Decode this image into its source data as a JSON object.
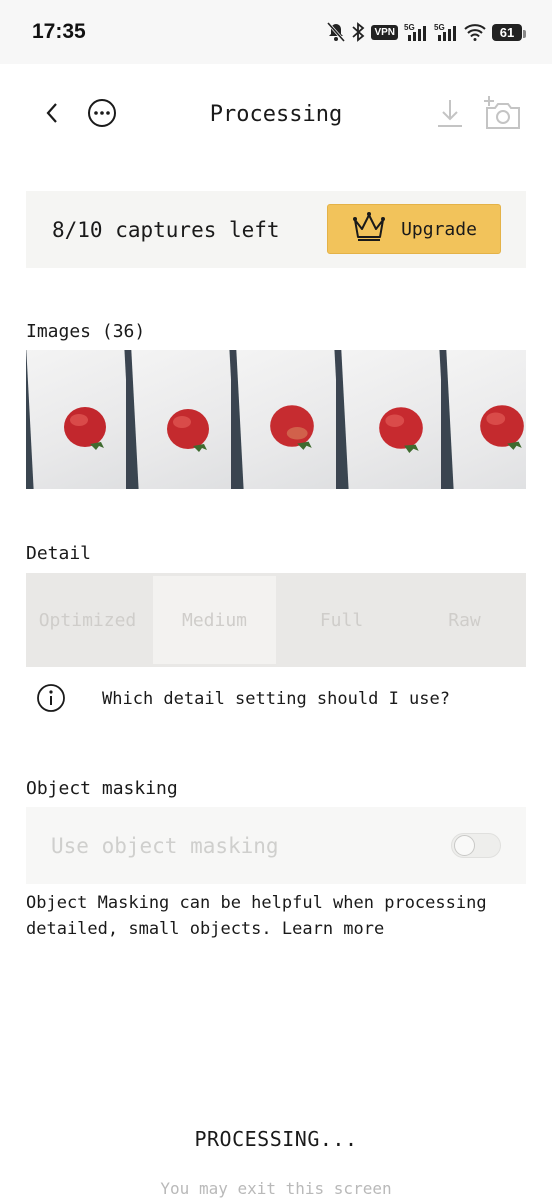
{
  "status_bar": {
    "time": "17:35",
    "icons": [
      "bell-off-icon",
      "bluetooth-icon",
      "vpn-icon",
      "signal-5g-icon",
      "signal-5g-icon",
      "wifi-icon",
      "battery-icon"
    ],
    "vpn_label": "VPN",
    "network_label": "5G",
    "battery": "61"
  },
  "header": {
    "title": "Processing",
    "back_icon": "chevron-left-icon",
    "more_icon": "more-horizontal-icon",
    "download_icon": "download-icon",
    "camera_icon": "add-camera-icon"
  },
  "upgrade_card": {
    "captures_left": "8/10 captures left",
    "button_label": "Upgrade",
    "button_icon": "crown-icon",
    "accent": "#f2c35b"
  },
  "images": {
    "label": "Images (36)",
    "thumbnails": [
      "strawberry-photo-1",
      "strawberry-photo-2",
      "strawberry-photo-3",
      "strawberry-photo-4",
      "strawberry-photo-5"
    ]
  },
  "detail": {
    "label": "Detail",
    "options": [
      "Optimized",
      "Medium",
      "Full",
      "Raw"
    ],
    "selected": "Medium",
    "help_icon": "info-icon",
    "help_text": "Which detail setting should I use?"
  },
  "object_masking": {
    "label": "Object masking",
    "toggle_label": "Use object masking",
    "enabled": false,
    "description": "Object Masking can be helpful when processing detailed, small objects.",
    "learn_more": "Learn more"
  },
  "footer": {
    "status": "PROCESSING...",
    "hint": "You may exit this screen"
  }
}
